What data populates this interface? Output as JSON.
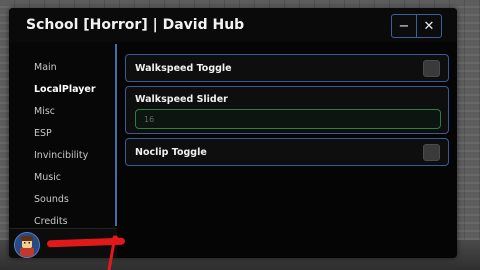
{
  "window": {
    "title": "School [Horror] | David Hub",
    "minimize_glyph": "−",
    "close_glyph": "✕"
  },
  "sidebar": {
    "items": [
      {
        "label": "Main",
        "active": false
      },
      {
        "label": "LocalPlayer",
        "active": true
      },
      {
        "label": "Misc",
        "active": false
      },
      {
        "label": "ESP",
        "active": false
      },
      {
        "label": "Invincibility",
        "active": false
      },
      {
        "label": "Music",
        "active": false
      },
      {
        "label": "Sounds",
        "active": false
      },
      {
        "label": "Credits",
        "active": false
      }
    ],
    "accent_color": "#4a6aa8"
  },
  "controls": {
    "walkspeed_toggle": {
      "label": "Walkspeed Toggle",
      "checked": false
    },
    "walkspeed_slider": {
      "label": "Walkspeed Slider",
      "placeholder": "16"
    },
    "noclip_toggle": {
      "label": "Noclip Toggle",
      "checked": false
    }
  },
  "colors": {
    "card_border": "#3b5a95",
    "input_border": "#2c7d46",
    "redaction": "#e11919"
  }
}
